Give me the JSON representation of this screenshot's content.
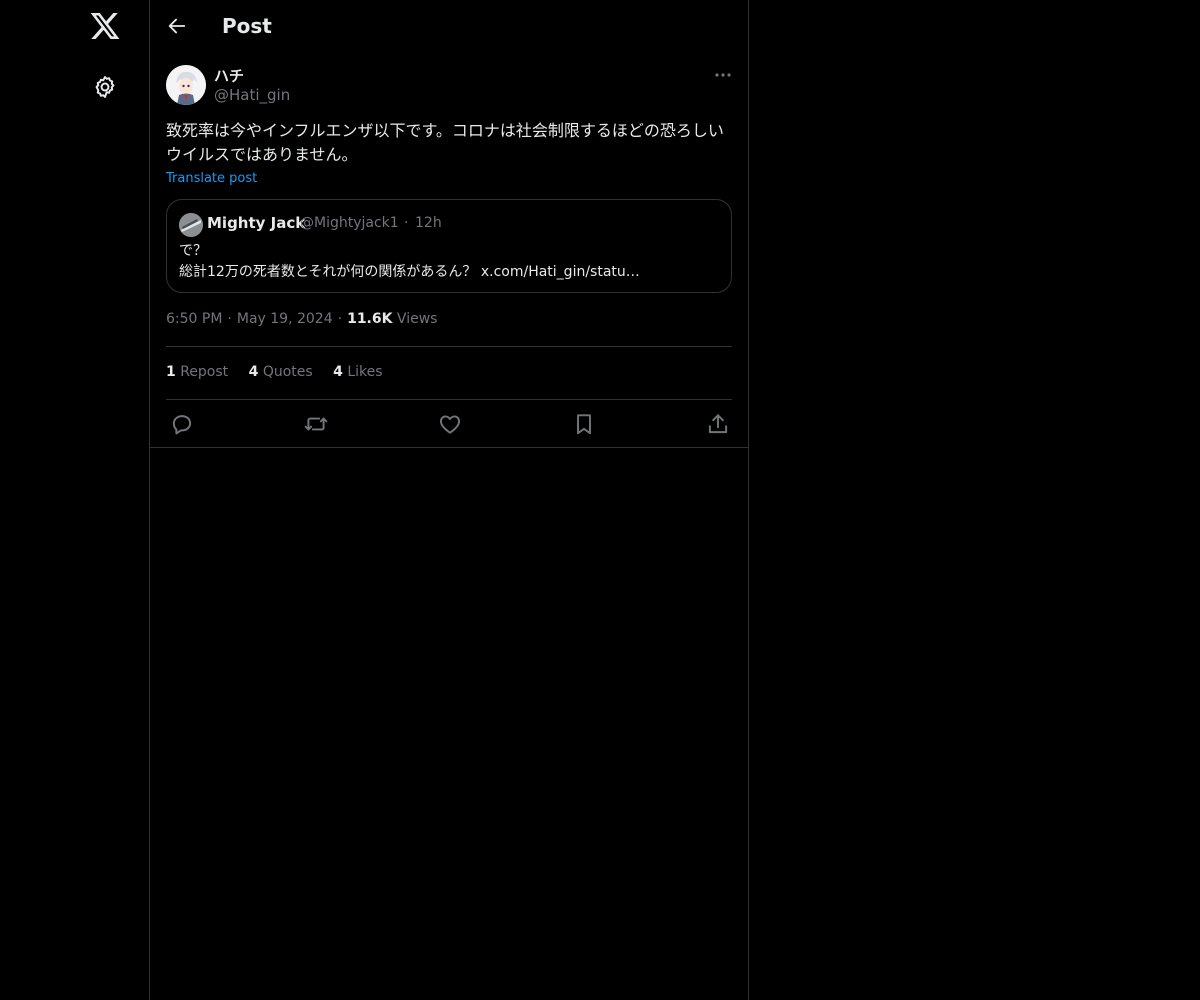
{
  "header": {
    "title": "Post"
  },
  "post": {
    "author_name": "ハチ",
    "author_handle": "@Hati_gin",
    "text": "致死率は今やインフルエンザ以下です。コロナは社会制限するほどの恐ろしいウイルスではありません。",
    "translate_label": "Translate post",
    "time": "6:50 PM",
    "date": "May 19, 2024",
    "views_count": "11.6K",
    "views_label": "Views"
  },
  "quote": {
    "author_name": "Mighty Jack",
    "author_handle": "@Mightyjack1",
    "separator": "·",
    "time": "12h",
    "line1": "で？",
    "line2": "総計12万の死者数とそれが何の関係があるん？ x.com/Hati_gin/statu…"
  },
  "meta": {
    "separator": "·"
  },
  "stats": {
    "reposts_count": "1",
    "reposts_label": "Repost",
    "quotes_count": "4",
    "quotes_label": "Quotes",
    "likes_count": "4",
    "likes_label": "Likes"
  },
  "icons": {
    "logo": "x-logo-icon",
    "settings": "gear-icon",
    "back": "back-arrow-icon",
    "more": "more-dots-icon",
    "reply": "reply-icon",
    "repost": "repost-icon",
    "like": "heart-icon",
    "bookmark": "bookmark-icon",
    "share": "share-icon"
  },
  "colors": {
    "background": "#000000",
    "text": "#e7e9ea",
    "secondary": "#71767b",
    "link": "#1d9bf0",
    "border": "#2f3336"
  }
}
